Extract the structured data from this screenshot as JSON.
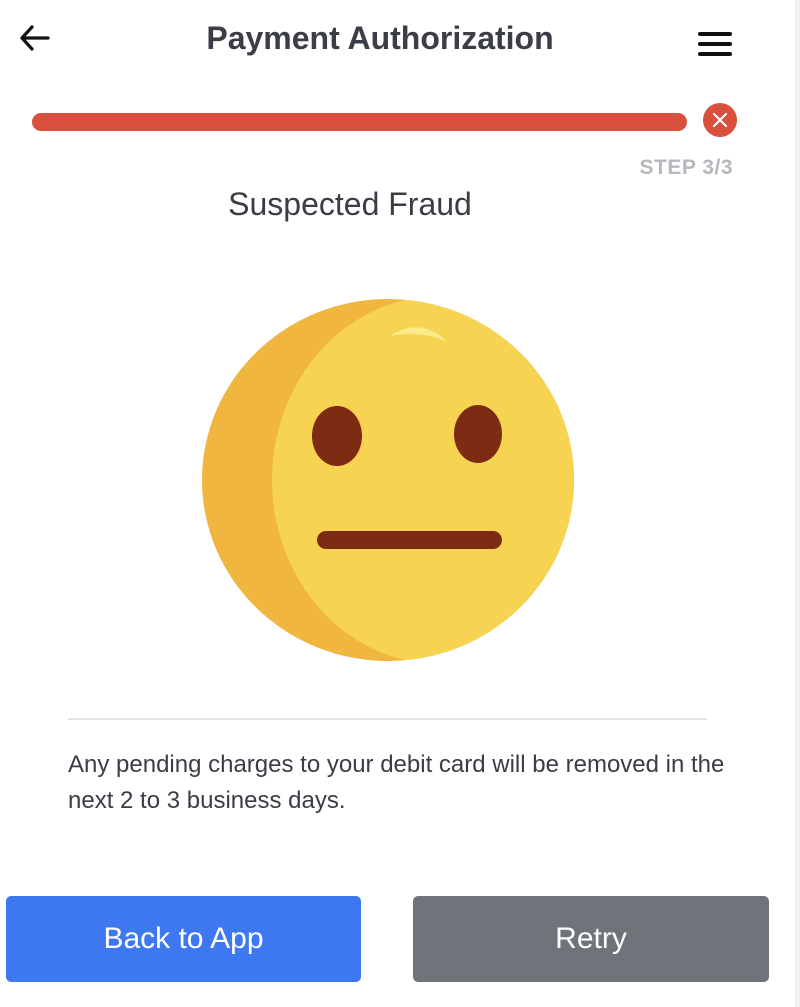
{
  "header": {
    "back_icon": "arrow-left-icon",
    "title": "Payment Authorization",
    "menu_icon": "hamburger-menu-icon"
  },
  "progress": {
    "value": 1.0,
    "color": "#d9503f",
    "status_icon": "close-circle-icon",
    "step_label": "STEP 3/3"
  },
  "status": {
    "title": "Suspected Fraud",
    "illustration": "neutral-face-emoji",
    "message": "Any pending charges to your debit card will be removed in the next 2 to 3 business days."
  },
  "actions": {
    "primary_label": "Back to App",
    "primary_color": "#3e78f0",
    "secondary_label": "Retry",
    "secondary_color": "#6f747b"
  }
}
